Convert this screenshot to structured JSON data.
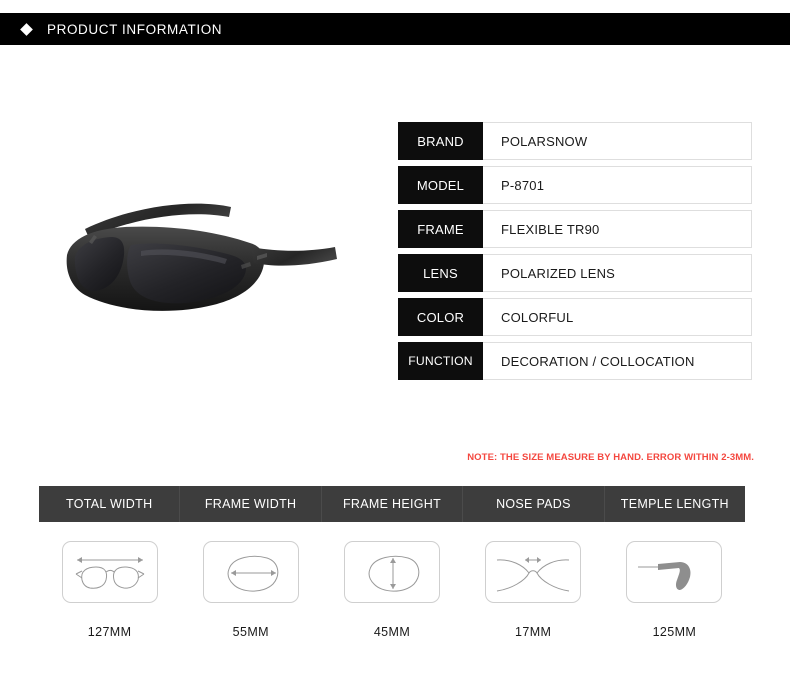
{
  "header": {
    "bullet_icon": "diamond-icon",
    "title": "PRODUCT INFORMATION"
  },
  "product_image": {
    "alt": "black polarized sport sunglasses"
  },
  "spec_table": {
    "rows": [
      {
        "label": "BRAND",
        "value": "POLARSNOW"
      },
      {
        "label": "MODEL",
        "value": "P-8701"
      },
      {
        "label": "FRAME",
        "value": "FLEXIBLE TR90"
      },
      {
        "label": "LENS",
        "value": "POLARIZED LENS"
      },
      {
        "label": "COLOR",
        "value": "COLORFUL"
      },
      {
        "label": "FUNCTION",
        "value": "DECORATION / COLLOCATION"
      }
    ]
  },
  "note": {
    "text": "NOTE: THE SIZE MEASURE BY HAND. ERROR WITHIN 2-3MM.",
    "color": "#f4473f"
  },
  "measurements": {
    "columns": [
      {
        "header": "TOTAL WIDTH",
        "value": "127MM",
        "diagram": "glasses-total-width-icon"
      },
      {
        "header": "FRAME WIDTH",
        "value": "55MM",
        "diagram": "lens-width-icon"
      },
      {
        "header": "FRAME HEIGHT",
        "value": "45MM",
        "diagram": "lens-height-icon"
      },
      {
        "header": "NOSE PADS",
        "value": "17MM",
        "diagram": "nose-bridge-icon"
      },
      {
        "header": "TEMPLE LENGTH",
        "value": "125MM",
        "diagram": "temple-arm-icon"
      }
    ]
  },
  "colors": {
    "header_bar": "#000000",
    "measure_header_bar": "#3d3d3d",
    "label_cell": "#0d0d0d",
    "page_background": "#ffffff"
  }
}
